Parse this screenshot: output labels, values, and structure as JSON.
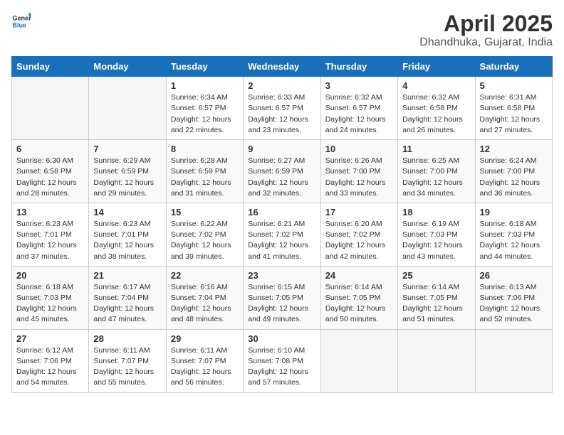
{
  "header": {
    "logo_general": "General",
    "logo_blue": "Blue",
    "month_title": "April 2025",
    "location": "Dhandhuka, Gujarat, India"
  },
  "days_of_week": [
    "Sunday",
    "Monday",
    "Tuesday",
    "Wednesday",
    "Thursday",
    "Friday",
    "Saturday"
  ],
  "weeks": [
    [
      {
        "day": "",
        "info": ""
      },
      {
        "day": "",
        "info": ""
      },
      {
        "day": "1",
        "info": "Sunrise: 6:34 AM\nSunset: 6:57 PM\nDaylight: 12 hours and 22 minutes."
      },
      {
        "day": "2",
        "info": "Sunrise: 6:33 AM\nSunset: 6:57 PM\nDaylight: 12 hours and 23 minutes."
      },
      {
        "day": "3",
        "info": "Sunrise: 6:32 AM\nSunset: 6:57 PM\nDaylight: 12 hours and 24 minutes."
      },
      {
        "day": "4",
        "info": "Sunrise: 6:32 AM\nSunset: 6:58 PM\nDaylight: 12 hours and 26 minutes."
      },
      {
        "day": "5",
        "info": "Sunrise: 6:31 AM\nSunset: 6:58 PM\nDaylight: 12 hours and 27 minutes."
      }
    ],
    [
      {
        "day": "6",
        "info": "Sunrise: 6:30 AM\nSunset: 6:58 PM\nDaylight: 12 hours and 28 minutes."
      },
      {
        "day": "7",
        "info": "Sunrise: 6:29 AM\nSunset: 6:59 PM\nDaylight: 12 hours and 29 minutes."
      },
      {
        "day": "8",
        "info": "Sunrise: 6:28 AM\nSunset: 6:59 PM\nDaylight: 12 hours and 31 minutes."
      },
      {
        "day": "9",
        "info": "Sunrise: 6:27 AM\nSunset: 6:59 PM\nDaylight: 12 hours and 32 minutes."
      },
      {
        "day": "10",
        "info": "Sunrise: 6:26 AM\nSunset: 7:00 PM\nDaylight: 12 hours and 33 minutes."
      },
      {
        "day": "11",
        "info": "Sunrise: 6:25 AM\nSunset: 7:00 PM\nDaylight: 12 hours and 34 minutes."
      },
      {
        "day": "12",
        "info": "Sunrise: 6:24 AM\nSunset: 7:00 PM\nDaylight: 12 hours and 36 minutes."
      }
    ],
    [
      {
        "day": "13",
        "info": "Sunrise: 6:23 AM\nSunset: 7:01 PM\nDaylight: 12 hours and 37 minutes."
      },
      {
        "day": "14",
        "info": "Sunrise: 6:23 AM\nSunset: 7:01 PM\nDaylight: 12 hours and 38 minutes."
      },
      {
        "day": "15",
        "info": "Sunrise: 6:22 AM\nSunset: 7:02 PM\nDaylight: 12 hours and 39 minutes."
      },
      {
        "day": "16",
        "info": "Sunrise: 6:21 AM\nSunset: 7:02 PM\nDaylight: 12 hours and 41 minutes."
      },
      {
        "day": "17",
        "info": "Sunrise: 6:20 AM\nSunset: 7:02 PM\nDaylight: 12 hours and 42 minutes."
      },
      {
        "day": "18",
        "info": "Sunrise: 6:19 AM\nSunset: 7:03 PM\nDaylight: 12 hours and 43 minutes."
      },
      {
        "day": "19",
        "info": "Sunrise: 6:18 AM\nSunset: 7:03 PM\nDaylight: 12 hours and 44 minutes."
      }
    ],
    [
      {
        "day": "20",
        "info": "Sunrise: 6:18 AM\nSunset: 7:03 PM\nDaylight: 12 hours and 45 minutes."
      },
      {
        "day": "21",
        "info": "Sunrise: 6:17 AM\nSunset: 7:04 PM\nDaylight: 12 hours and 47 minutes."
      },
      {
        "day": "22",
        "info": "Sunrise: 6:16 AM\nSunset: 7:04 PM\nDaylight: 12 hours and 48 minutes."
      },
      {
        "day": "23",
        "info": "Sunrise: 6:15 AM\nSunset: 7:05 PM\nDaylight: 12 hours and 49 minutes."
      },
      {
        "day": "24",
        "info": "Sunrise: 6:14 AM\nSunset: 7:05 PM\nDaylight: 12 hours and 50 minutes."
      },
      {
        "day": "25",
        "info": "Sunrise: 6:14 AM\nSunset: 7:05 PM\nDaylight: 12 hours and 51 minutes."
      },
      {
        "day": "26",
        "info": "Sunrise: 6:13 AM\nSunset: 7:06 PM\nDaylight: 12 hours and 52 minutes."
      }
    ],
    [
      {
        "day": "27",
        "info": "Sunrise: 6:12 AM\nSunset: 7:06 PM\nDaylight: 12 hours and 54 minutes."
      },
      {
        "day": "28",
        "info": "Sunrise: 6:11 AM\nSunset: 7:07 PM\nDaylight: 12 hours and 55 minutes."
      },
      {
        "day": "29",
        "info": "Sunrise: 6:11 AM\nSunset: 7:07 PM\nDaylight: 12 hours and 56 minutes."
      },
      {
        "day": "30",
        "info": "Sunrise: 6:10 AM\nSunset: 7:08 PM\nDaylight: 12 hours and 57 minutes."
      },
      {
        "day": "",
        "info": ""
      },
      {
        "day": "",
        "info": ""
      },
      {
        "day": "",
        "info": ""
      }
    ]
  ]
}
